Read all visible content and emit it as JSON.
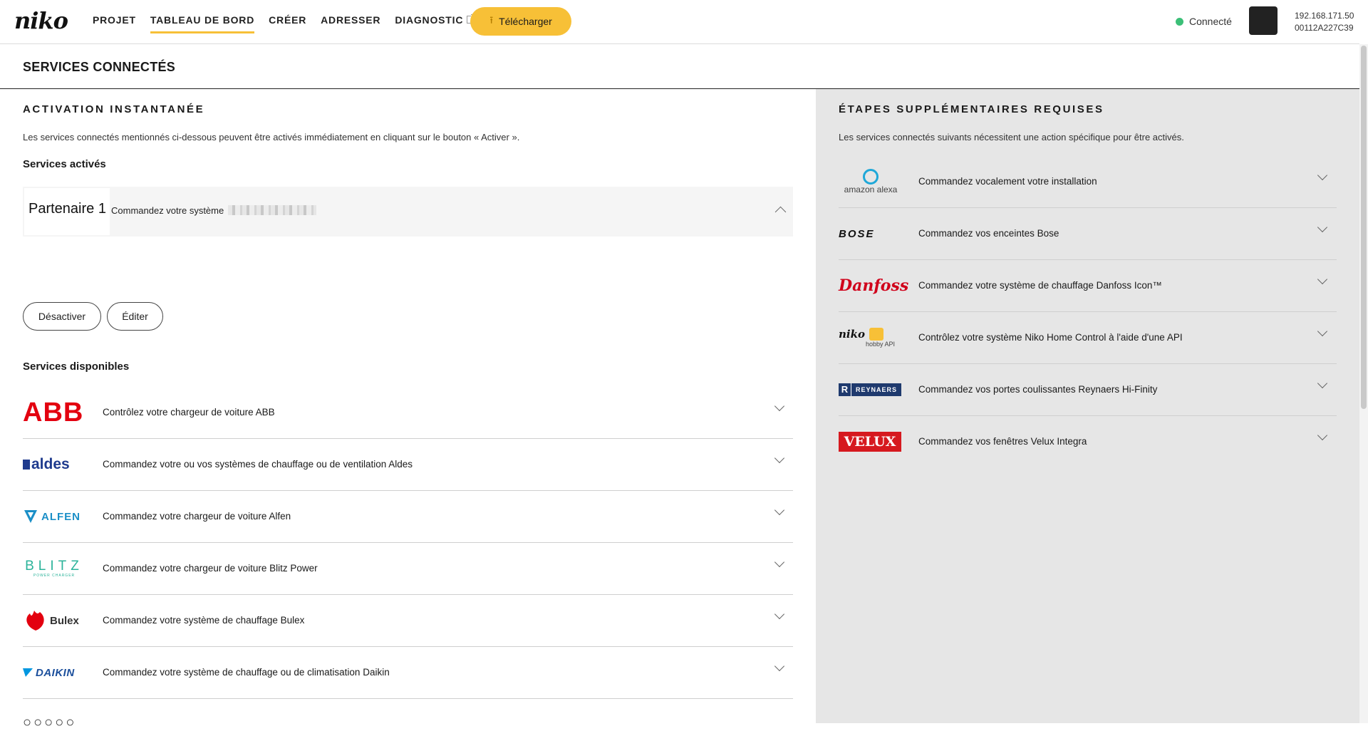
{
  "header": {
    "logo": "niko",
    "nav": [
      {
        "label": "PROJET",
        "active": false,
        "external": false
      },
      {
        "label": "TABLEAU DE BORD",
        "active": true,
        "external": false
      },
      {
        "label": "CRÉER",
        "active": false,
        "external": false
      },
      {
        "label": "ADRESSER",
        "active": false,
        "external": false
      },
      {
        "label": "DIAGNOSTIC",
        "active": false,
        "external": true
      }
    ],
    "download_label": "Télécharger",
    "status_label": "Connecté",
    "status_color": "#3bbf77",
    "ip": "192.168.171.50",
    "mac": "00112A227C39"
  },
  "page_title": "SERVICES CONNECTÉS",
  "left": {
    "heading": "ACTIVATION INSTANTANÉE",
    "description": "Les services connectés mentionnés ci-dessous peuvent être activés immédiatement en cliquant sur le bouton « Activer ».",
    "active_heading": "Services activés",
    "active_card": {
      "partner": "Partenaire 1",
      "text": "Commandez votre système"
    },
    "deactivate_label": "Désactiver",
    "edit_label": "Éditer",
    "available_heading": "Services disponibles",
    "services": [
      {
        "brand": "ABB",
        "text": "Contrôlez votre chargeur de voiture ABB"
      },
      {
        "brand": "aldes",
        "text": "Commandez votre ou vos systèmes de chauffage ou de ventilation Aldes"
      },
      {
        "brand": "ALFEN",
        "text": "Commandez votre chargeur de voiture Alfen"
      },
      {
        "brand": "BLITZ",
        "brand_sub": "POWER CHARGER",
        "text": "Commandez votre chargeur de voiture Blitz Power"
      },
      {
        "brand": "Bulex",
        "text": "Commandez votre système de chauffage Bulex"
      },
      {
        "brand": "DAIKIN",
        "text": "Commandez votre système de chauffage ou de climatisation Daikin"
      }
    ]
  },
  "right": {
    "heading": "ÉTAPES SUPPLÉMENTAIRES REQUISES",
    "description": "Les services connectés suivants nécessitent une action spécifique pour être activés.",
    "services": [
      {
        "brand": "amazon alexa",
        "text": "Commandez vocalement votre installation"
      },
      {
        "brand": "BOSE",
        "text": "Commandez vos enceintes Bose"
      },
      {
        "brand": "Danfoss",
        "text": "Commandez votre système de chauffage Danfoss Icon™"
      },
      {
        "brand": "niko",
        "brand_sub": "hobby API",
        "text": "Contrôlez votre système Niko Home Control à l'aide d'une API"
      },
      {
        "brand": "REYNAERS",
        "text": "Commandez vos portes coulissantes Reynaers Hi-Finity"
      },
      {
        "brand": "VELUX",
        "text": "Commandez vos fenêtres Velux Integra"
      }
    ]
  }
}
